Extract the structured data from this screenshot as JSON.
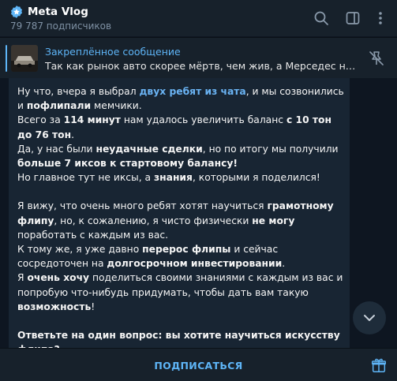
{
  "header": {
    "title": "Meta Vlog",
    "subtitle": "79 787 подписчиков",
    "icons": [
      "verified-icon",
      "search-icon",
      "sidebar-toggle-icon",
      "more-icon"
    ]
  },
  "pinned": {
    "title": "Закреплённое сообщение",
    "text": "Так как рынок авто скорее мёртв, чем жив, а Мерседес не вп..."
  },
  "message": {
    "p1": [
      "Ну что, вчера я выбрал ",
      "двух ребят из чата",
      ", и мы созвонились и ",
      "пофлипали",
      " мемчики."
    ],
    "p2": [
      "Всего за ",
      "114 минут",
      " нам удалось увеличить баланс ",
      "с 10 тон до 76 тон",
      "."
    ],
    "p3": [
      "Да, у нас были ",
      "неудачные сделки",
      ", но по итогу мы получили ",
      "больше 7 иксов к стартовому балансу!"
    ],
    "p4": [
      "Но главное тут не иксы, а ",
      "знания",
      ", которыми я поделился!"
    ],
    "p5": [
      "Я вижу, что очень много ребят хотят научиться ",
      "грамотному флипу",
      ", но, к сожалению, я чисто физически ",
      "не могу",
      " поработать с каждым из вас."
    ],
    "p6": [
      "К тому же, я уже давно ",
      "перерос флипы",
      " и сейчас сосредоточен на ",
      "долгосрочном инвестировании",
      "."
    ],
    "p7": [
      "Я ",
      "очень хочу",
      " поделиться своими знаниями с каждым из вас и попробую что-нибудь придумать, чтобы дать вам такую ",
      "возможность",
      "!"
    ],
    "p8": [
      "Ответьте на один вопрос: вы хотите научиться искусству флипа?"
    ]
  },
  "footer": {
    "subscribe_label": "ПОДПИСАТЬСЯ"
  },
  "colors": {
    "accent": "#5eb5f7",
    "background": "#0e1621",
    "panel": "#17212b",
    "bubble": "#182533"
  }
}
